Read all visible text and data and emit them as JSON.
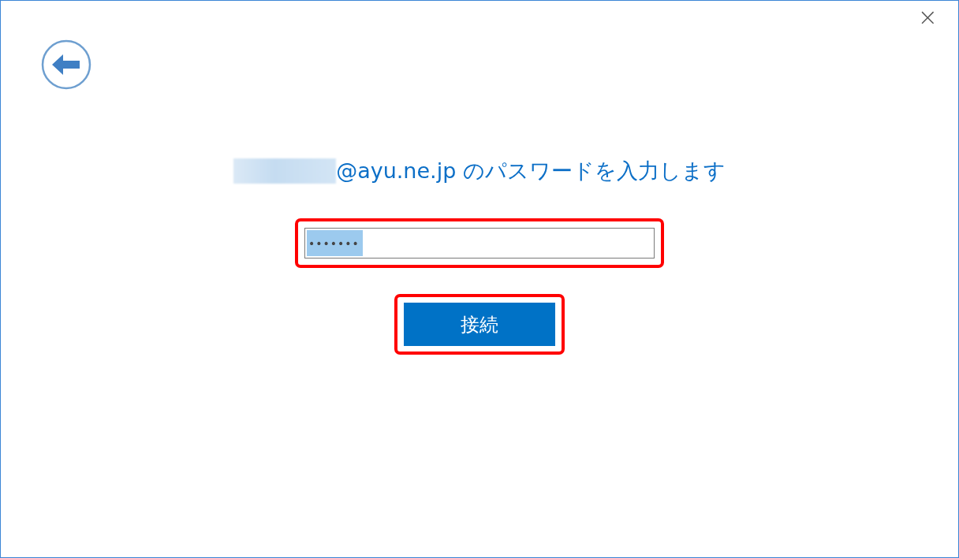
{
  "window": {
    "close_glyph": "×"
  },
  "heading": {
    "redacted": true,
    "text": "@ayu.ne.jp のパスワードを入力します"
  },
  "password_field": {
    "value": "•••••••",
    "text_selected": true,
    "highlighted": true
  },
  "connect_button": {
    "label": "接続",
    "highlighted": true
  }
}
